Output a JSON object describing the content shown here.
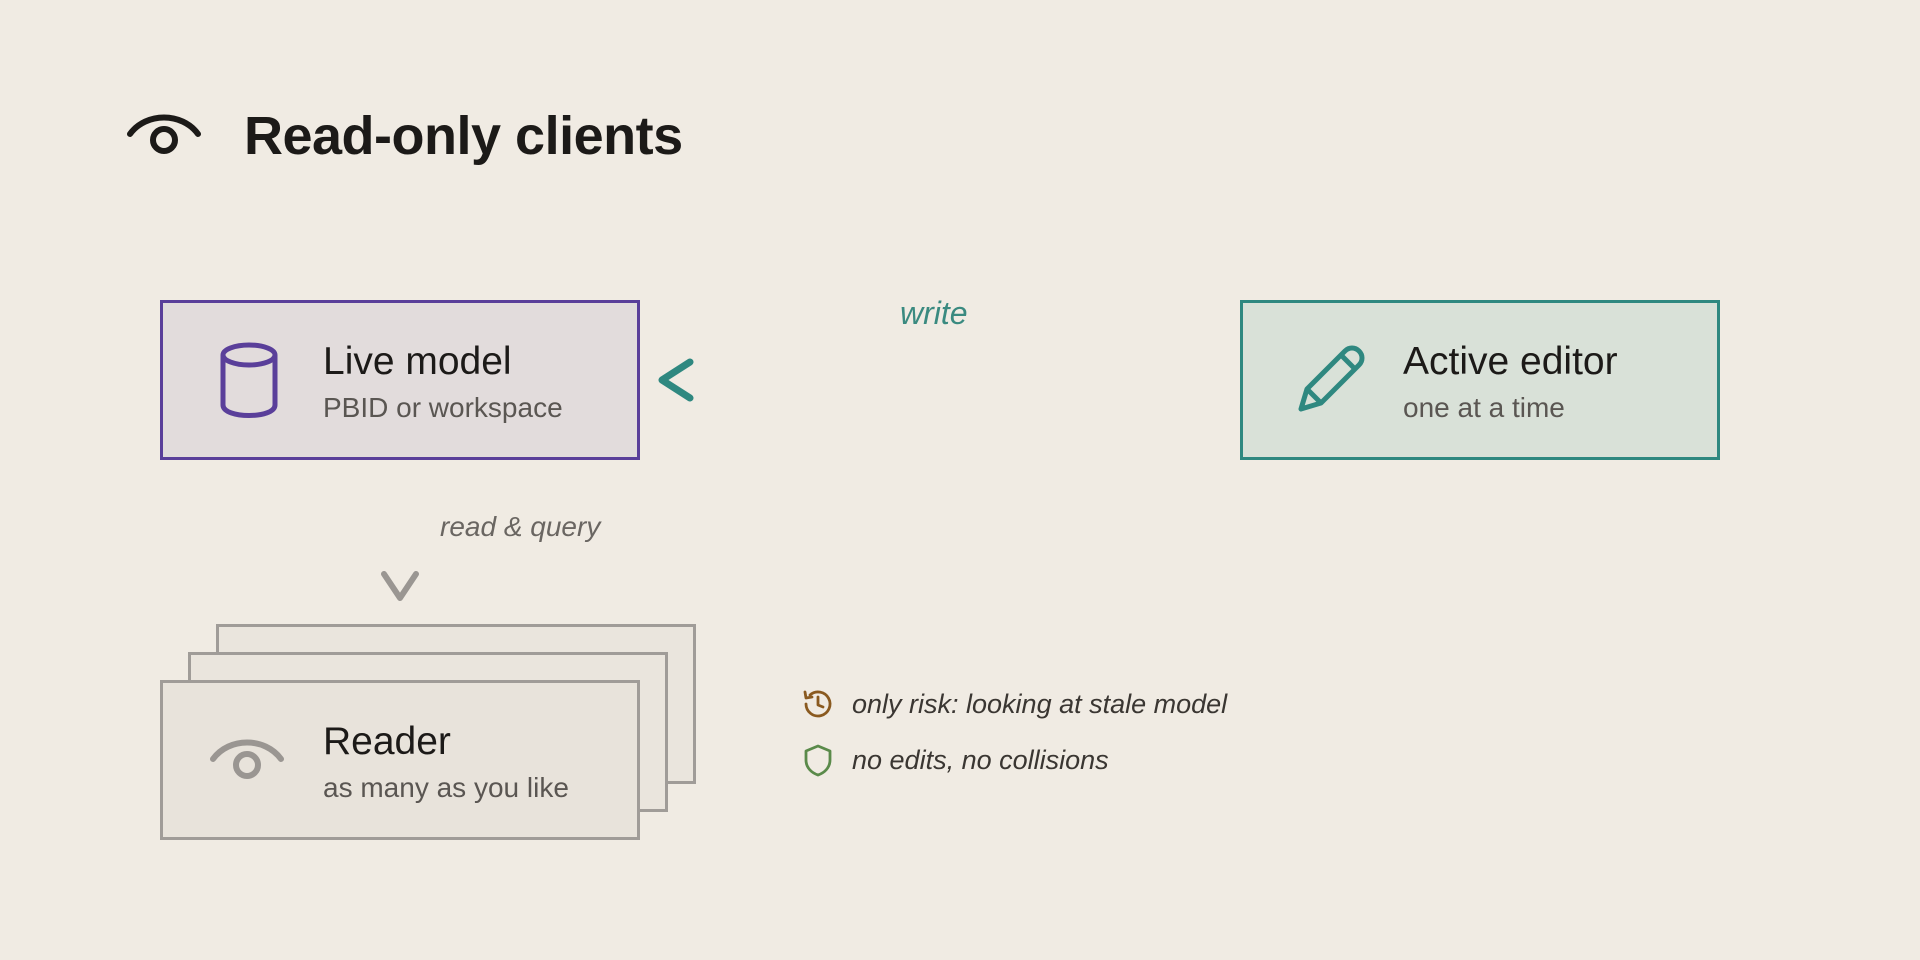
{
  "header": {
    "title": "Read-only clients",
    "icon": "eye-icon"
  },
  "nodes": {
    "live_model": {
      "title": "Live model",
      "subtitle": "PBID or workspace",
      "icon": "database-icon",
      "color": "#5a3f9a"
    },
    "active_editor": {
      "title": "Active editor",
      "subtitle": "one at a time",
      "icon": "pencil-icon",
      "color": "#2f8880"
    },
    "reader": {
      "title": "Reader",
      "subtitle": "as many as you like",
      "icon": "eye-icon",
      "color": "#a09c98"
    }
  },
  "edges": {
    "write": {
      "label": "write",
      "from": "active_editor",
      "to": "live_model",
      "color": "#2f8880"
    },
    "read": {
      "label": "read & query",
      "from": "live_model",
      "to": "reader",
      "color": "#9a9692"
    }
  },
  "notes": [
    {
      "icon": "history-clock-icon",
      "text": "only risk: looking at stale model",
      "color": "#8a5a20"
    },
    {
      "icon": "shield-icon",
      "text": "no edits, no collisions",
      "color": "#5a8a4a"
    }
  ]
}
